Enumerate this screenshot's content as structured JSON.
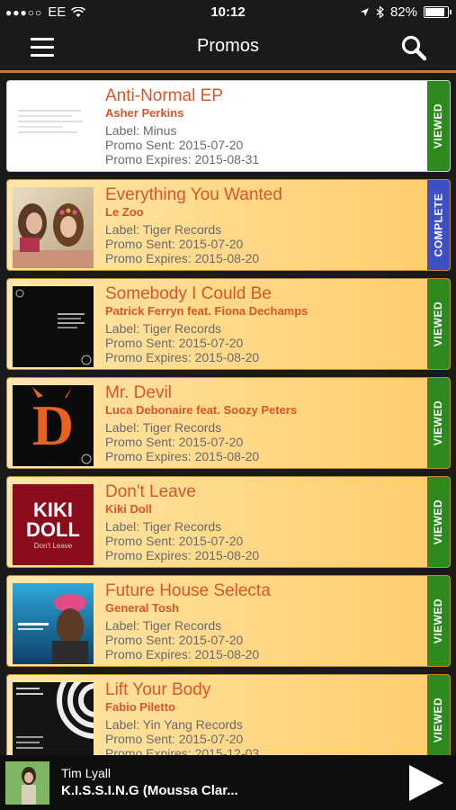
{
  "status_bar": {
    "carrier": "EE",
    "time": "10:12",
    "battery": "82%"
  },
  "header": {
    "title": "Promos",
    "menu_icon": "hamburger-menu-icon",
    "search_icon": "search-icon"
  },
  "promos": [
    {
      "title": "Anti-Normal EP",
      "artist": "Asher Perkins",
      "label": "Label: Minus",
      "sent": "Promo Sent: 2015-07-20",
      "expires": "Promo Expires: 2015-08-31",
      "status": "VIEWED",
      "status_color": "#2e8a1f"
    },
    {
      "title": "Everything You Wanted",
      "artist": "Le Zoo",
      "label": "Label: Tiger Records",
      "sent": "Promo Sent: 2015-07-20",
      "expires": "Promo Expires: 2015-08-20",
      "status": "COMPLETE",
      "status_color": "#3d4fc4"
    },
    {
      "title": "Somebody I Could Be",
      "artist": "Patrick Ferryn feat. Fiona Dechamps",
      "label": "Label: Tiger Records",
      "sent": "Promo Sent: 2015-07-20",
      "expires": "Promo Expires: 2015-08-20",
      "status": "VIEWED",
      "status_color": "#2e8a1f"
    },
    {
      "title": "Mr. Devil",
      "artist": "Luca Debonaire feat. Soozy Peters",
      "label": "Label: Tiger Records",
      "sent": "Promo Sent: 2015-07-20",
      "expires": "Promo Expires: 2015-08-20",
      "status": "VIEWED",
      "status_color": "#2e8a1f"
    },
    {
      "title": "Don't Leave",
      "artist": "Kiki Doll",
      "label": "Label: Tiger Records",
      "sent": "Promo Sent: 2015-07-20",
      "expires": "Promo Expires: 2015-08-20",
      "status": "VIEWED",
      "status_color": "#2e8a1f"
    },
    {
      "title": "Future House Selecta",
      "artist": "General Tosh",
      "label": "Label: Tiger Records",
      "sent": "Promo Sent: 2015-07-20",
      "expires": "Promo Expires: 2015-08-20",
      "status": "VIEWED",
      "status_color": "#2e8a1f"
    },
    {
      "title": "Lift Your Body",
      "artist": "Fabio Piletto",
      "label": "Label: Yin Yang Records",
      "sent": "Promo Sent: 2015-07-20",
      "expires": "Promo Expires: 2015-12-03",
      "status": "VIEWED",
      "status_color": "#2e8a1f"
    }
  ],
  "artwork": {
    "mr_devil_letter": "D",
    "kiki_doll_line1": "KIKI",
    "kiki_doll_line2": "DOLL",
    "kiki_doll_sub": "Don't Leave"
  },
  "player": {
    "artist": "Tim Lyall",
    "track": "K.I.S.S.I.N.G (Moussa Clar...",
    "play_icon": "play-icon"
  },
  "colors": {
    "accent_orange": "#d0762b",
    "title_red": "#d4572a",
    "viewed_green": "#2e8a1f",
    "complete_blue": "#3d4fc4"
  }
}
